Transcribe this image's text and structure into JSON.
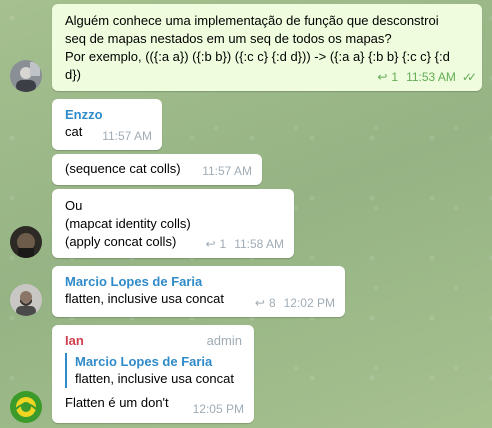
{
  "messages": [
    {
      "lines": [
        "Alguém conhece uma implementação de função que desconstroi",
        "seq de mapas nestados em um seq de todos os mapas?",
        "Por exemplo, (({:a a}) ({:b b}) ({:c c} {:d d})) -> ({:a a} {:b b} {:c c} {:d",
        "d})"
      ],
      "replies": "1",
      "time": "11:53 AM"
    },
    {
      "sender": "Enzzo",
      "text": "cat",
      "time": "11:57 AM"
    },
    {
      "text": "(sequence cat colls)",
      "time": "11:57 AM"
    },
    {
      "lines": [
        "Ou",
        "(mapcat identity colls)",
        "(apply concat colls)"
      ],
      "replies": "1",
      "time": "11:58 AM"
    },
    {
      "sender": "Marcio Lopes de Faria",
      "text": "flatten, inclusive usa concat",
      "replies": "8",
      "time": "12:02 PM"
    },
    {
      "sender": "Ian",
      "badge": "admin",
      "quote_name": "Marcio Lopes de Faria",
      "quote_text": "flatten, inclusive usa concat",
      "text": "Flatten é um don't",
      "time": "12:05 PM"
    }
  ],
  "icons": {
    "reply": "reply-arrow-icon",
    "read": "double-check-icon"
  },
  "colors": {
    "outgoing_bubble": "#effdde",
    "incoming_bubble": "#ffffff",
    "sender_name": "#2f8bc9",
    "admin_sender_name": "#d0414f",
    "read_check": "#62ac55"
  }
}
